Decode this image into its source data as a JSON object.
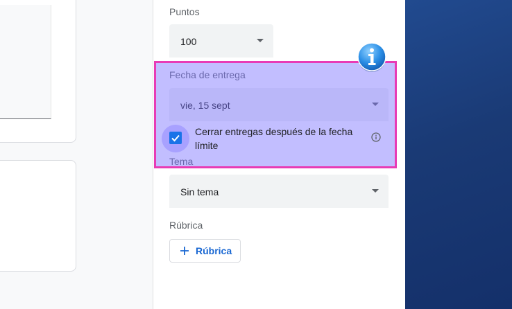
{
  "points": {
    "label": "Puntos",
    "value": "100"
  },
  "due_date": {
    "label": "Fecha de entrega",
    "value": "vie, 15 sept",
    "close_after_due_label": "Cerrar entregas después de la fecha límite",
    "close_after_due_checked": true
  },
  "topic": {
    "label": "Tema",
    "value": "Sin tema"
  },
  "rubric": {
    "label": "Rúbrica",
    "button_label": "Rúbrica"
  },
  "icons": {
    "dropdown": "caret-down-icon",
    "info": "info-icon",
    "badge": "info-badge-icon",
    "add": "plus-icon",
    "check": "check-icon"
  },
  "colors": {
    "accent": "#1a73e8",
    "highlight_fill": "#7a6eff",
    "highlight_border": "#e83bb5",
    "desktop_bg": "#1c3a78"
  }
}
